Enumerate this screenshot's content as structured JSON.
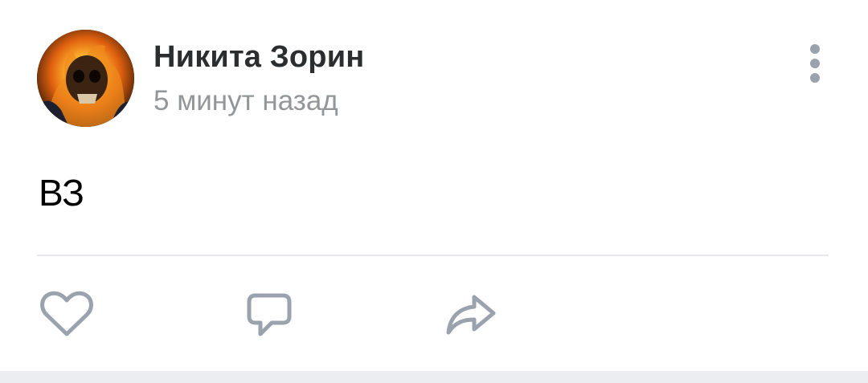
{
  "post": {
    "author_name": "Никита Зорин",
    "time": "5 минут назад",
    "text": "ВЗ"
  },
  "icons": {
    "more": "more-vertical-icon",
    "like": "heart-icon",
    "comment": "comment-icon",
    "share": "share-icon"
  },
  "colors": {
    "icon": "#99a2ad",
    "author": "#2c2d2e",
    "time": "#939699",
    "divider": "#e7e8ec",
    "feed_gap": "#ebedf0"
  }
}
